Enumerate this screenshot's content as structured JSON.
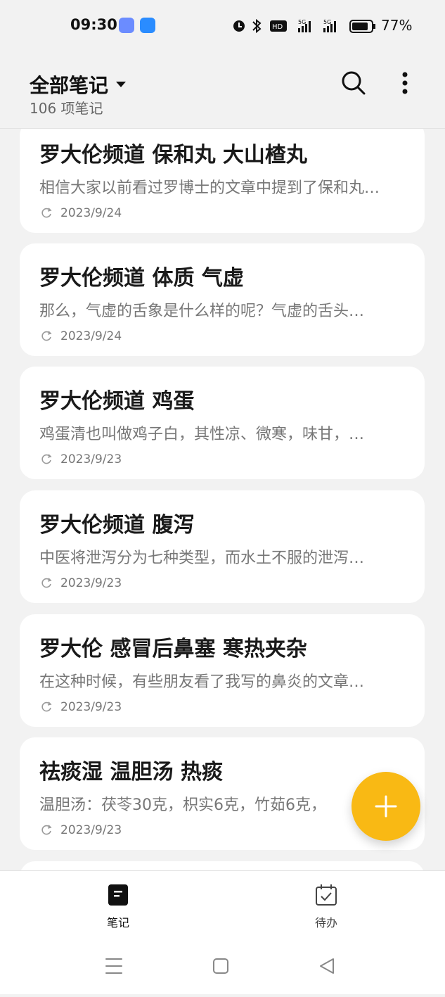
{
  "status_bar": {
    "time": "09:30",
    "battery": "77%",
    "icons": [
      "alarm-icon",
      "bluetooth-icon",
      "hd-icon",
      "5g-signal-icon",
      "5g-signal-icon",
      "battery-icon"
    ]
  },
  "header": {
    "title": "全部笔记",
    "subtitle": "106 项笔记",
    "search_icon": "search-icon",
    "more_icon": "more-vertical-icon"
  },
  "notes": [
    {
      "title": "罗大伦频道 保和丸 大山楂丸",
      "preview": "相信大家以前看过罗博士的文章中提到了保和丸…",
      "date": "2023/9/24"
    },
    {
      "title": "罗大伦频道 体质 气虚",
      "preview": "那么，气虚的舌象是什么样的呢？气虚的舌头…",
      "date": "2023/9/24"
    },
    {
      "title": "罗大伦频道 鸡蛋",
      "preview": "鸡蛋清也叫做鸡子白，其性凉、微寒，味甘，…",
      "date": "2023/9/23"
    },
    {
      "title": "罗大伦频道 腹泻",
      "preview": "中医将泄泻分为七种类型，而水土不服的泄泻…",
      "date": "2023/9/23"
    },
    {
      "title": "罗大伦 感冒后鼻塞 寒热夹杂",
      "preview": "在这种时候，有些朋友看了我写的鼻炎的文章…",
      "date": "2023/9/23"
    },
    {
      "title": "祛痰湿 温胆汤 热痰",
      "preview": "温胆汤：茯苓30克，枳实6克，竹茹6克，",
      "date": "2023/9/23"
    }
  ],
  "fab": {
    "icon": "plus-icon",
    "color": "#f9b914"
  },
  "bottom_nav": {
    "items": [
      {
        "label": "笔记",
        "icon": "note-icon",
        "active": true
      },
      {
        "label": "待办",
        "icon": "calendar-check-icon",
        "active": false
      }
    ]
  },
  "system_nav": [
    "menu-icon",
    "home-icon",
    "back-icon"
  ]
}
